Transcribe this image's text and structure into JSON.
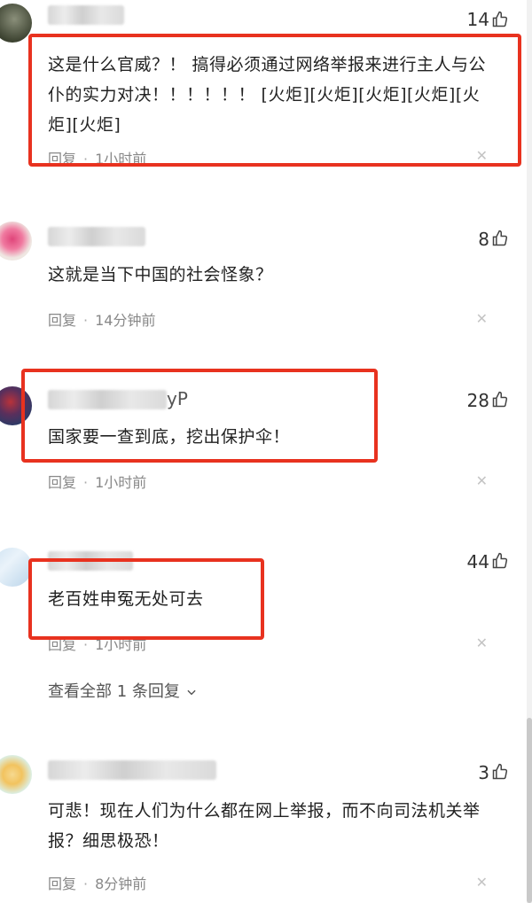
{
  "comments": [
    {
      "likes": "14",
      "text": "这是什么官威？！ 搞得必须通过网络举报来进行主人与公仆的实力对决！！！！！！ [火炬][火炬][火炬][火炬][火炬][火炬]",
      "reply_label": "回复",
      "time": "1小时前"
    },
    {
      "likes": "8",
      "text": "这就是当下中国的社会怪象？",
      "reply_label": "回复",
      "time": "14分钟前"
    },
    {
      "name_suffix": "yP",
      "likes": "28",
      "text": "国家要一查到底，挖出保护伞！",
      "reply_label": "回复",
      "time": "1小时前"
    },
    {
      "likes": "44",
      "text": "老百姓申冤无处可去",
      "reply_label": "回复",
      "time": "1小时前",
      "view_replies": "查看全部 1 条回复"
    },
    {
      "likes": "3",
      "text": "可悲！现在人们为什么都在网上举报，而不向司法机关举报？细思极恐！",
      "reply_label": "回复",
      "time": "8分钟前"
    }
  ],
  "colors": {
    "highlight": "#e8321f",
    "meta": "#888888",
    "text": "#222222"
  },
  "icons": {
    "like": "thumbs-up-icon",
    "close": "close-icon",
    "expand": "chevron-down-icon"
  }
}
